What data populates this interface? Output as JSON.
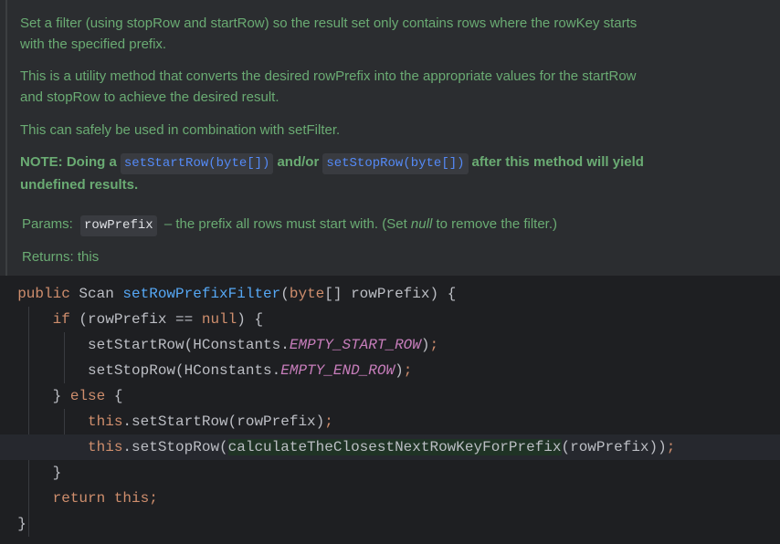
{
  "doc": {
    "para1": "Set a filter (using stopRow and startRow) so the result set only contains rows where the rowKey starts with the specified prefix.",
    "para1_line1": "Set a filter (using stopRow and startRow) so the result set only contains rows where the rowKey starts",
    "para1_line2": "with the specified prefix.",
    "para2_line1": "This is a utility method that converts the desired rowPrefix into the appropriate values for the startRow",
    "para2_line2": "and stopRow to achieve the desired result.",
    "para3": "This can safely be used in combination with setFilter.",
    "note": {
      "prefix": "NOTE: Doing a",
      "link1": "setStartRow(byte[])",
      "middle": "and/or",
      "link2": "setStopRow(byte[])",
      "suffix": "after this method will yield",
      "line2": "undefined results."
    },
    "params": {
      "label": "Params:",
      "name": "rowPrefix",
      "desc_before": "– the prefix all rows must start with. (Set",
      "desc_italic": "null",
      "desc_after": "to remove the filter.)"
    },
    "returns": {
      "label": "Returns:",
      "value": "this"
    }
  },
  "code": {
    "l1": {
      "kw": "public",
      "type": " Scan ",
      "fn": "setRowPrefixFilter",
      "open": "(",
      "kw2": "byte",
      "rest": "[] rowPrefix) {"
    },
    "l2": {
      "kw": "if",
      "mid": " (rowPrefix == ",
      "kw2": "null",
      "rest": ") {"
    },
    "l3": {
      "call": "setStartRow(HConstants.",
      "const": "EMPTY_START_ROW",
      "end": ");"
    },
    "l4": {
      "call": "setStopRow(HConstants.",
      "const": "EMPTY_END_ROW",
      "end": ");"
    },
    "l5": {
      "brace": "} ",
      "kw": "else",
      "rest": " {"
    },
    "l6": {
      "kw": "this",
      "call": ".setStartRow(rowPrefix)",
      "end": ";"
    },
    "l7": {
      "kw": "this",
      "call": ".setStopRow(",
      "hl": "calculateTheClosestNextRowKeyForPrefix",
      "rest": "(rowPrefix))",
      "end": ";"
    },
    "l8": {
      "brace": "}"
    },
    "l9": {
      "kw": "return this",
      "end": ";"
    },
    "l10": {
      "brace": "}"
    }
  },
  "colors": {
    "doc_text": "#6aab73",
    "keyword": "#cf8e6d",
    "function": "#56a8f5",
    "constant": "#c77dbb",
    "link": "#548af7"
  }
}
